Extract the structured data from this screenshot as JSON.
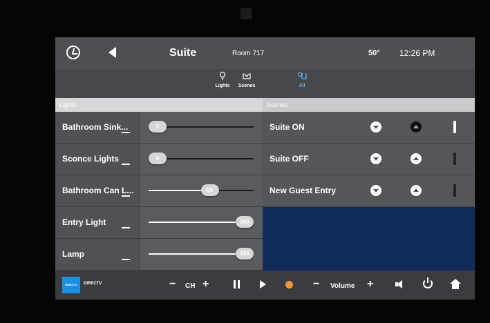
{
  "header": {
    "room_title": "Suite",
    "room_number": "Room 717",
    "temperature": "50°",
    "time": "12:26 PM"
  },
  "filters": [
    {
      "label": "Lights",
      "icon": "bulb-icon",
      "selected": false
    },
    {
      "label": "Scenes",
      "icon": "scenes-icon",
      "selected": false
    },
    {
      "label": "All",
      "icon": "all-icon",
      "selected": true
    }
  ],
  "lights": {
    "header": "Lights",
    "items": [
      {
        "label": "Bathroom Sink...",
        "level": 0,
        "level_label": "0"
      },
      {
        "label": "Sconce Lights",
        "level": 0,
        "level_label": "0"
      },
      {
        "label": "Bathroom Can L...",
        "level": 60,
        "level_label": "60"
      },
      {
        "label": "Entry Light",
        "level": 100,
        "level_label": "100"
      },
      {
        "label": "Lamp",
        "level": 100,
        "level_label": "100"
      }
    ]
  },
  "scenes": {
    "header": "Scenes",
    "items": [
      {
        "label": "Suite ON",
        "active": true
      },
      {
        "label": "Suite OFF",
        "active": false
      },
      {
        "label": "New Guest Entry",
        "active": false
      }
    ]
  },
  "bottom": {
    "source_logo": "DIRECTV",
    "source_label": "DIRECTV",
    "ch_label": "CH",
    "volume_label": "Volume",
    "minus": "−",
    "plus": "+"
  },
  "colors": {
    "accent": "#5fb3ff",
    "record": "#f39a3c",
    "directv_blue": "#1c8fe0"
  }
}
